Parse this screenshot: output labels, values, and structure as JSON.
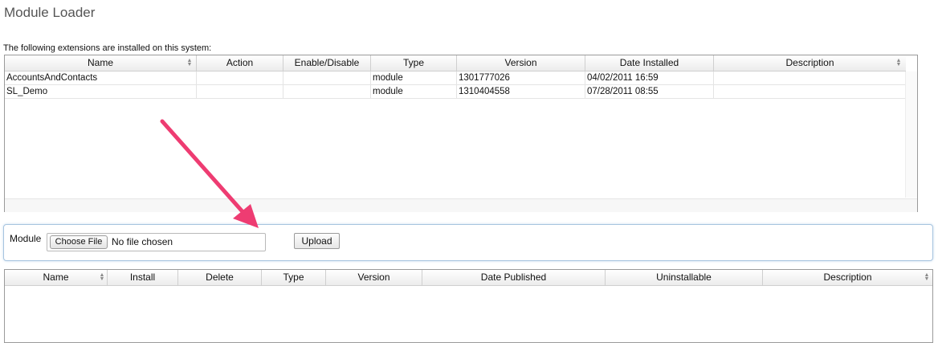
{
  "page": {
    "title": "Module Loader",
    "installed_caption": "The following extensions are installed on this system:"
  },
  "installed_table": {
    "columns": [
      "Name",
      "Action",
      "Enable/Disable",
      "Type",
      "Version",
      "Date Installed",
      "Description"
    ],
    "rows": [
      {
        "name": "AccountsAndContacts",
        "action": "",
        "enable": "",
        "type": "module",
        "version": "1301777026",
        "date": "04/02/2011 16:59",
        "description": ""
      },
      {
        "name": "SL_Demo",
        "action": "",
        "enable": "",
        "type": "module",
        "version": "1310404558",
        "date": "07/28/2011 08:55",
        "description": ""
      }
    ]
  },
  "upload": {
    "label": "Module",
    "choose_label": "Choose File",
    "file_status": "No file chosen",
    "upload_label": "Upload"
  },
  "available_table": {
    "columns": [
      "Name",
      "Install",
      "Delete",
      "Type",
      "Version",
      "Date Published",
      "Uninstallable",
      "Description"
    ],
    "rows": []
  },
  "colors": {
    "arrow": "#ee3c72",
    "panel_border": "#9a9a9a",
    "upload_border": "#a7c4df"
  }
}
